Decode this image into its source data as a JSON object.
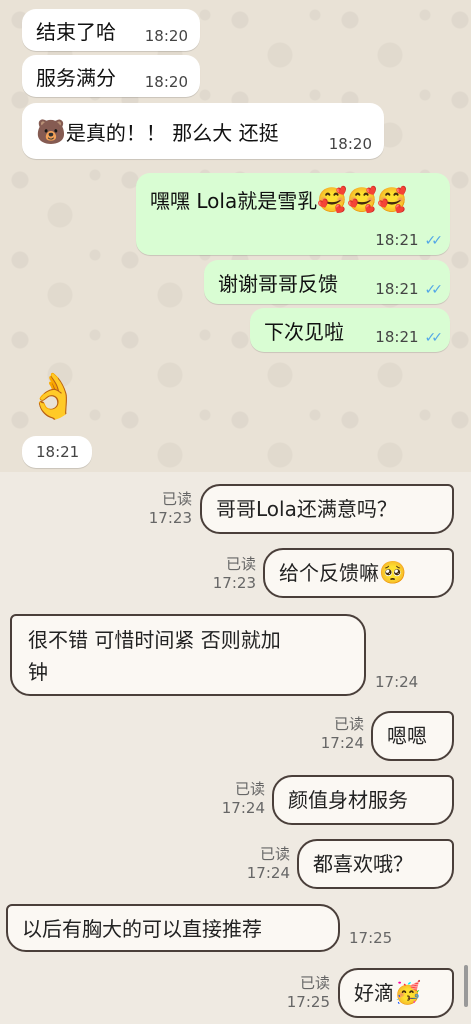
{
  "top_chat": {
    "messages": [
      {
        "text": "结束了哈",
        "time": "18:20"
      },
      {
        "text": "服务满分",
        "time": "18:20"
      },
      {
        "emoji": "🐻",
        "text": "是真的！！ 那么大 还挺",
        "time": "18:20"
      },
      {
        "text": "嘿嘿 Lola就是雪乳",
        "emoji": "🥰🥰🥰",
        "time": "18:21"
      },
      {
        "text": "谢谢哥哥反馈",
        "time": "18:21"
      },
      {
        "text": "下次见啦",
        "time": "18:21"
      },
      {
        "emoji": "👌",
        "time": "18:21"
      }
    ],
    "tick_icon": "✓✓",
    "colors": {
      "incoming": "#ffffff",
      "outgoing": "#d9fdd3",
      "tick": "#53a7e7"
    }
  },
  "bottom_chat": {
    "messages": [
      {
        "read": "已读",
        "time": "17:23",
        "text": "哥哥Lola还满意吗？"
      },
      {
        "read": "已读",
        "time": "17:23",
        "text": "给个反馈嘛",
        "emoji": "🥺"
      },
      {
        "text_line1": "很不错 可惜时间紧 否则就加",
        "text_line2": "钟",
        "time": "17:24"
      },
      {
        "read": "已读",
        "time": "17:24",
        "text": "嗯嗯"
      },
      {
        "read": "已读",
        "time": "17:24",
        "text": "颜值身材服务"
      },
      {
        "read": "已读",
        "time": "17:24",
        "text": "都喜欢哦？"
      },
      {
        "text": "以后有胸大的可以直接推荐",
        "time": "17:25"
      },
      {
        "read": "已读",
        "time": "17:25",
        "text": "好滴",
        "emoji": "🥳"
      }
    ]
  }
}
